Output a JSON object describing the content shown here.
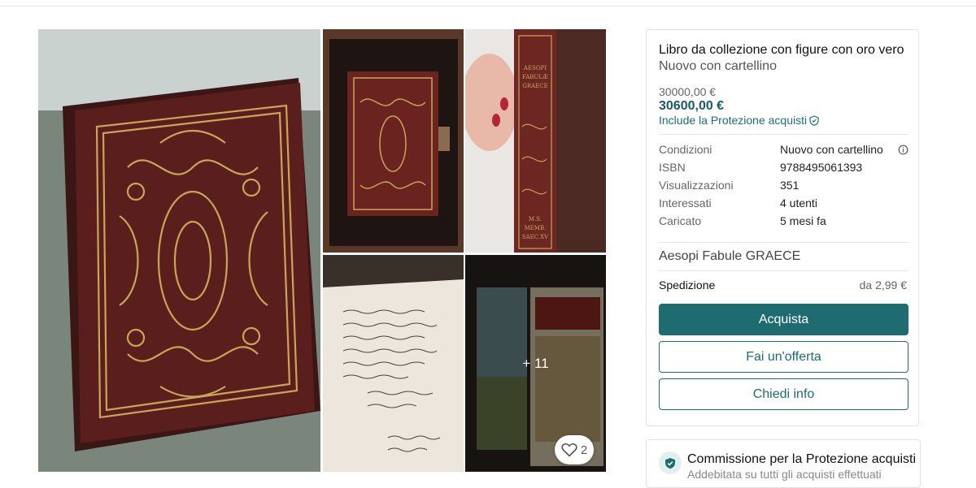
{
  "gallery": {
    "more_label": "+ 11",
    "favorite_count": "2"
  },
  "item": {
    "title": "Libro da collezione con figure con oro vero",
    "subtitle": "Nuovo con cartellino",
    "old_price": "30000,00 €",
    "price": "30600,00 €",
    "protection_note": "Include la Protezione acquisti",
    "details": [
      {
        "label": "Condizioni",
        "value": "Nuovo con cartellino"
      },
      {
        "label": "ISBN",
        "value": "9788495061393"
      },
      {
        "label": "Visualizzazioni",
        "value": "351"
      },
      {
        "label": "Interessati",
        "value": "4 utenti"
      },
      {
        "label": "Caricato",
        "value": "5 mesi fa"
      }
    ],
    "description": "Aesopi Fabule GRAECE",
    "shipping_label": "Spedizione",
    "shipping_price": "da 2,99 €"
  },
  "actions": {
    "buy": "Acquista",
    "offer": "Fai un'offerta",
    "ask": "Chiedi info"
  },
  "fee_panel": {
    "title": "Commissione per la Protezione acquisti",
    "subtitle": "Addebitata su tutti gli acquisti effettuati"
  },
  "colors": {
    "accent": "#1f6c70",
    "leather": "#4a1a18",
    "gold": "#c9a55a"
  }
}
